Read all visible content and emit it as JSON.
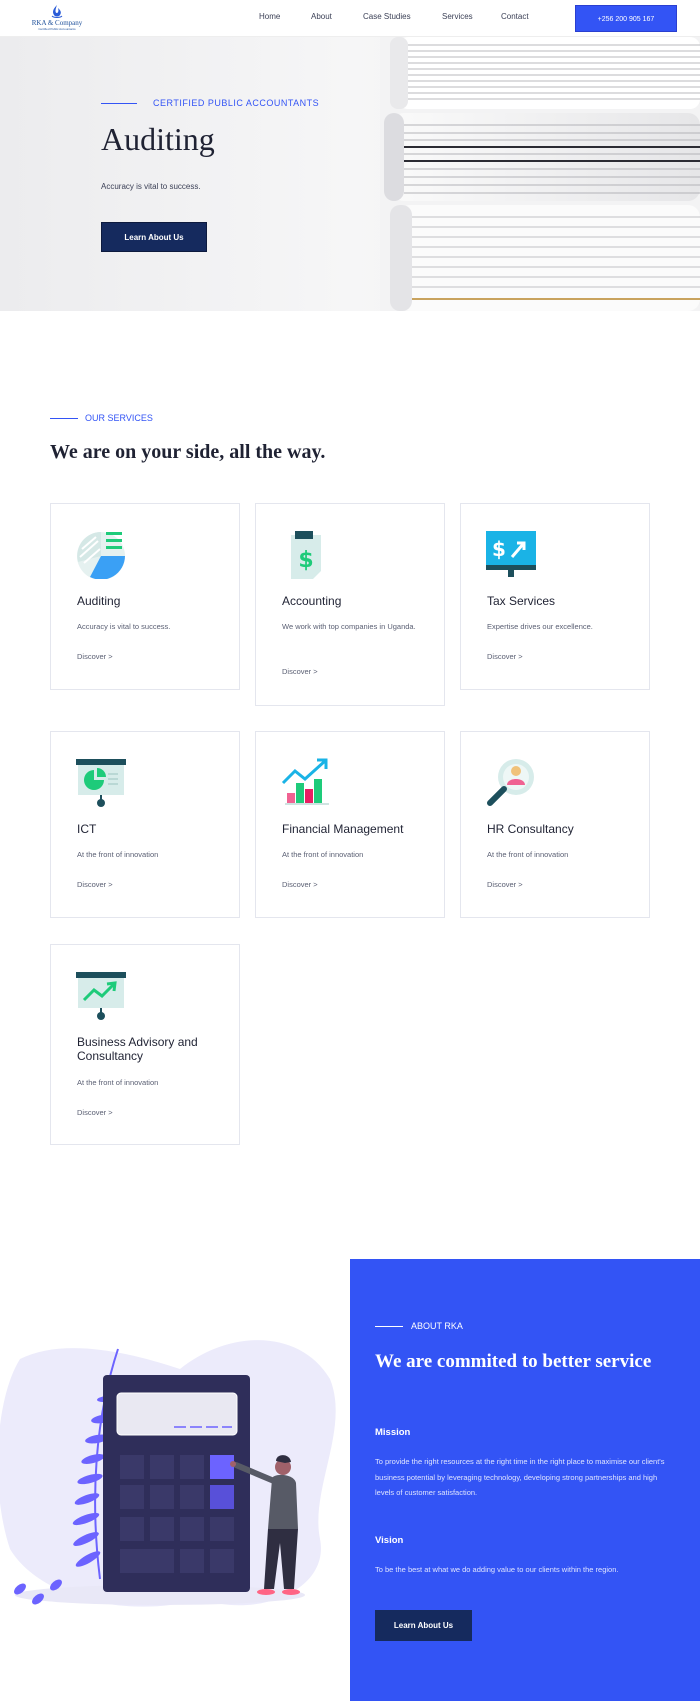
{
  "nav": {
    "logo_name": "RKA & Company",
    "logo_tagline": "Certified Public Accountants",
    "links": [
      "Home",
      "About",
      "Case Studies",
      "Services",
      "Contact"
    ],
    "phone": "+256 200 905 167"
  },
  "hero": {
    "eyebrow": "CERTIFIED PUBLIC ACCOUNTANTS",
    "title": "Auditing",
    "subtitle": "Accuracy is vital to success.",
    "button": "Learn About Us"
  },
  "services": {
    "eyebrow": "OUR SERVICES",
    "title": "We are on your side, all the way.",
    "items": [
      {
        "title": "Auditing",
        "desc": "Accuracy is vital to success.",
        "link": "Discover >"
      },
      {
        "title": "Accounting",
        "desc": "We work with top companies in Uganda.",
        "link": "Discover >"
      },
      {
        "title": "Tax Services",
        "desc": "Expertise drives our excellence.",
        "link": "Discover >"
      },
      {
        "title": "ICT",
        "desc": "At the front of innovation",
        "link": "Discover >"
      },
      {
        "title": "Financial Management",
        "desc": "At the front of innovation",
        "link": "Discover >"
      },
      {
        "title": "HR Consultancy",
        "desc": "At the front of innovation",
        "link": "Discover >"
      },
      {
        "title": "Business Advisory and Consultancy",
        "desc": "At the front of innovation",
        "link": "Discover >"
      }
    ]
  },
  "about": {
    "eyebrow": "ABOUT RKA",
    "title": "We are commited to better service",
    "mission_heading": "Mission",
    "mission_text": "To provide the right resources at the right time in the right place to maximise our client's business potential by leveraging technology, developing strong partnerships and high levels of customer satisfaction.",
    "vision_heading": "Vision",
    "vision_text": "To be the best at what we do adding value to our clients within the region.",
    "button": "Learn About Us"
  },
  "colors": {
    "accent": "#3354f5",
    "navy": "#152a5e",
    "text": "#1f2233"
  }
}
